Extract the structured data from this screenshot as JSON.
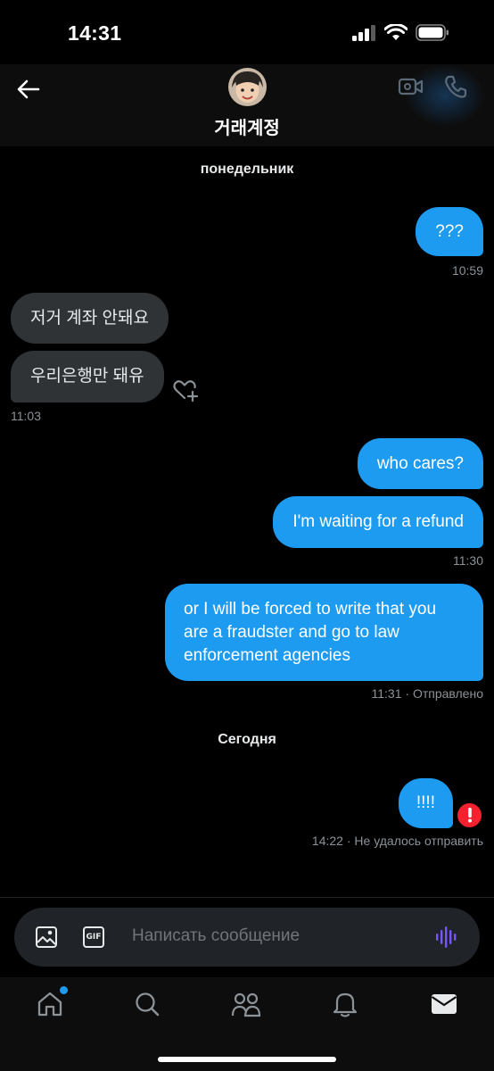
{
  "status_bar": {
    "time": "14:31"
  },
  "header": {
    "title": "거래계정",
    "back_icon": "arrow-left-icon",
    "video_icon": "video-call-icon",
    "call_icon": "phone-icon"
  },
  "messages": [
    {
      "type": "date",
      "text": "понедельник"
    },
    {
      "type": "out",
      "text": "???",
      "time": "10:59"
    },
    {
      "type": "in",
      "text": "저거 계좌 안돼요"
    },
    {
      "type": "in",
      "text": "우리은행만 돼유",
      "time": "11:03"
    },
    {
      "type": "out",
      "text": "who cares?"
    },
    {
      "type": "out",
      "text": "I'm waiting for a refund",
      "time": "11:30"
    },
    {
      "type": "out",
      "text": "or I will be forced to write that you are a fraudster and go to law enforcement agencies",
      "time": "11:31",
      "status": "· Отправлено"
    },
    {
      "type": "date",
      "text": "Сегодня"
    },
    {
      "type": "out",
      "text": "!!!!",
      "time": "14:22",
      "status": "· Не удалось отправить",
      "failed": true
    }
  ],
  "composer": {
    "placeholder": "Написать сообщение",
    "gif_label": "GIF"
  },
  "tabs": [
    {
      "name": "home",
      "icon": "home-icon",
      "notification": true
    },
    {
      "name": "search",
      "icon": "search-icon"
    },
    {
      "name": "communities",
      "icon": "people-icon"
    },
    {
      "name": "notifications",
      "icon": "bell-icon"
    },
    {
      "name": "messages",
      "icon": "mail-icon",
      "active": true
    }
  ],
  "colors": {
    "accent": "#1d9bf0",
    "incoming_bubble": "#2f3336",
    "error": "#f4212e",
    "voice": "#7856ff"
  }
}
